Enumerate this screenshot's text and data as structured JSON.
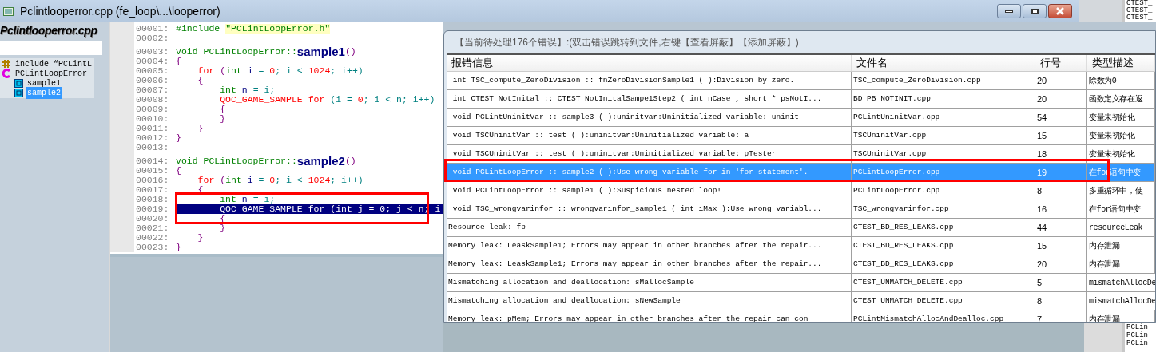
{
  "window": {
    "title": "Pclintlooperror.cpp (fe_loop\\...\\looperror)"
  },
  "side_list_top": [
    "CTEST_",
    "CTEST_",
    "CTEST_"
  ],
  "side_list_bottom": [
    "PCLin",
    "PCLin",
    "PCLin"
  ],
  "file_panel": {
    "title": "Pclintlooperror.cpp",
    "tree": [
      {
        "kind": "include",
        "label": "include “PCLintL",
        "selected": false
      },
      {
        "kind": "class",
        "label": "PCLintLoopError",
        "selected": false,
        "children": [
          {
            "kind": "method",
            "label": "sample1",
            "selected": false
          },
          {
            "kind": "method",
            "label": "sample2",
            "selected": true
          }
        ]
      }
    ]
  },
  "editor": {
    "lines": [
      {
        "number": "00001:",
        "selected": false,
        "tokens": [
          {
            "kind": "pp",
            "t": "#include "
          },
          {
            "kind": "str",
            "t": "\"PCLintLoopError.h\""
          }
        ]
      },
      {
        "number": "00002:",
        "selected": false
      },
      {
        "number": "00003:",
        "selected": false,
        "tokens": [
          {
            "kind": "type",
            "t": "void PCLintLoopError::"
          },
          {
            "kind": "fn",
            "t": "sample1"
          },
          {
            "kind": "br",
            "t": "()"
          }
        ]
      },
      {
        "number": "00004:",
        "selected": false,
        "tokens": [
          {
            "kind": "br",
            "t": "{"
          }
        ]
      },
      {
        "number": "00005:",
        "selected": false,
        "tokens": [
          {
            "kind": "kw",
            "t": "    for "
          },
          {
            "kind": "br",
            "t": "("
          },
          {
            "kind": "type",
            "t": "int "
          },
          {
            "kind": "id",
            "t": "i"
          },
          {
            "kind": "op",
            "t": " = "
          },
          {
            "kind": "num",
            "t": "0"
          },
          {
            "kind": "op",
            "t": "; i < "
          },
          {
            "kind": "num",
            "t": "1024"
          },
          {
            "kind": "op",
            "t": "; i++)"
          }
        ]
      },
      {
        "number": "00006:",
        "selected": false,
        "tokens": [
          {
            "kind": "br",
            "t": "    {"
          }
        ]
      },
      {
        "number": "00007:",
        "selected": false,
        "tokens": [
          {
            "kind": "type",
            "t": "        int "
          },
          {
            "kind": "id",
            "t": "n"
          },
          {
            "kind": "op",
            "t": " = i;"
          }
        ]
      },
      {
        "number": "00008:",
        "selected": false,
        "tokens": [
          {
            "kind": "kw",
            "t": "        QOC_GAME_SAMPLE for "
          },
          {
            "kind": "op",
            "t": "(i = "
          },
          {
            "kind": "num",
            "t": "0"
          },
          {
            "kind": "op",
            "t": "; i < n; i++)"
          }
        ]
      },
      {
        "number": "00009:",
        "selected": false,
        "tokens": [
          {
            "kind": "br",
            "t": "        {"
          }
        ]
      },
      {
        "number": "00010:",
        "selected": false,
        "tokens": [
          {
            "kind": "br",
            "t": "        }"
          }
        ]
      },
      {
        "number": "00011:",
        "selected": false,
        "tokens": [
          {
            "kind": "br",
            "t": "    }"
          }
        ]
      },
      {
        "number": "00012:",
        "selected": false,
        "tokens": [
          {
            "kind": "br",
            "t": "}"
          }
        ]
      },
      {
        "number": "00013:",
        "selected": false
      },
      {
        "number": "00014:",
        "selected": false,
        "tokens": [
          {
            "kind": "type",
            "t": "void PCLintLoopError::"
          },
          {
            "kind": "fn",
            "t": "sample2"
          },
          {
            "kind": "br",
            "t": "()"
          }
        ]
      },
      {
        "number": "00015:",
        "selected": false,
        "tokens": [
          {
            "kind": "br",
            "t": "{"
          }
        ]
      },
      {
        "number": "00016:",
        "selected": false,
        "tokens": [
          {
            "kind": "kw",
            "t": "    for "
          },
          {
            "kind": "br",
            "t": "("
          },
          {
            "kind": "type",
            "t": "int "
          },
          {
            "kind": "id",
            "t": "i"
          },
          {
            "kind": "op",
            "t": " = "
          },
          {
            "kind": "num",
            "t": "0"
          },
          {
            "kind": "op",
            "t": "; i < "
          },
          {
            "kind": "num",
            "t": "1024"
          },
          {
            "kind": "op",
            "t": "; i++)"
          }
        ]
      },
      {
        "number": "00017:",
        "selected": false,
        "tokens": [
          {
            "kind": "br",
            "t": "    {"
          }
        ]
      },
      {
        "number": "00018:",
        "selected": false,
        "tokens": [
          {
            "kind": "type",
            "t": "        int "
          },
          {
            "kind": "id",
            "t": "n"
          },
          {
            "kind": "op",
            "t": " = i;"
          }
        ]
      },
      {
        "number": "00019:",
        "selected": true,
        "tokens": [
          {
            "kind": "kw",
            "t": "        QOC_GAME_SAMPLE for "
          },
          {
            "kind": "op",
            "t": "(int j = "
          },
          {
            "kind": "num",
            "t": "0"
          },
          {
            "kind": "op",
            "t": "; j < n; i"
          }
        ]
      },
      {
        "number": "00020:",
        "selected": false,
        "tokens": [
          {
            "kind": "br",
            "t": "        {"
          }
        ]
      },
      {
        "number": "00021:",
        "selected": false,
        "tokens": [
          {
            "kind": "br",
            "t": "        }"
          }
        ]
      },
      {
        "number": "00022:",
        "selected": false,
        "tokens": [
          {
            "kind": "br",
            "t": "    }"
          }
        ]
      },
      {
        "number": "00023:",
        "selected": false,
        "tokens": [
          {
            "kind": "br",
            "t": "}"
          }
        ]
      }
    ]
  },
  "error_dialog": {
    "header": "【当前待处理176个错误】:(双击错误跳转到文件,右键【查看屏蔽】【添加屏蔽】)",
    "columns": [
      "报错信息",
      "文件名",
      "行号",
      "类型描述"
    ],
    "rows": [
      {
        "message": " int TSC_compute_ZeroDivision :: fnZeroDivisionSample1 ( ):Division by zero.",
        "file": "TSC_compute_ZeroDivision.cpp",
        "line": "20",
        "type": "除数为0",
        "selected": false
      },
      {
        "message": " int CTEST_NotInital :: CTEST_NotInitalSampe1Step2 ( int nCase , short * psNotI...",
        "file": "BD_PB_NOTINIT.cpp",
        "line": "20",
        "type": "函数定义存在返",
        "selected": false
      },
      {
        "message": " void PCLintUninitVar :: sample3 ( ):uninitvar:Uninitialized variable: uninit",
        "file": "PCLintUninitVar.cpp",
        "line": "54",
        "type": "变量未初始化",
        "selected": false
      },
      {
        "message": " void TSCUninitVar :: test ( ):uninitvar:Uninitialized variable: a",
        "file": "TSCUninitVar.cpp",
        "line": "15",
        "type": "变量未初始化",
        "selected": false
      },
      {
        "message": " void TSCUninitVar :: test ( ):uninitvar:Uninitialized variable: pTester",
        "file": "TSCUninitVar.cpp",
        "line": "18",
        "type": "变量未初始化",
        "selected": false
      },
      {
        "message": " void PCLintLoopError :: sample2 ( ):Use wrong variable for in 'for statement'.",
        "file": "PCLintLoopError.cpp",
        "line": "19",
        "type": "在for语句中变",
        "selected": true
      },
      {
        "message": " void PCLintLoopError :: sample1 ( ):Suspicious nested loop!",
        "file": "PCLintLoopError.cpp",
        "line": "8",
        "type": "多重循环中，使",
        "selected": false
      },
      {
        "message": " void TSC_wrongvarinfor :: wrongvarinfor_sample1 ( int iMax ):Use wrong variabl...",
        "file": "TSC_wrongvarinfor.cpp",
        "line": "16",
        "type": "在for语句中变",
        "selected": false
      },
      {
        "message": "Resource leak: fp",
        "file": "CTEST_BD_RES_LEAKS.cpp",
        "line": "44",
        "type": "resourceLeak",
        "selected": false
      },
      {
        "message": "Memory leak: LeaskSample1; Errors may appear in other branches after the repair...",
        "file": "CTEST_BD_RES_LEAKS.cpp",
        "line": "15",
        "type": "内存泄漏",
        "selected": false
      },
      {
        "message": "Memory leak: LeaskSample1; Errors may appear in other branches after the repair...",
        "file": "CTEST_BD_RES_LEAKS.cpp",
        "line": "20",
        "type": "内存泄漏",
        "selected": false
      },
      {
        "message": "Mismatching allocation and deallocation: sMallocSample",
        "file": "CTEST_UNMATCH_DELETE.cpp",
        "line": "5",
        "type": "mismatchAllocDe",
        "selected": false
      },
      {
        "message": "Mismatching allocation and deallocation: sNewSample",
        "file": "CTEST_UNMATCH_DELETE.cpp",
        "line": "8",
        "type": "mismatchAllocDe",
        "selected": false
      },
      {
        "message": "Memory leak: pMem; Errors may appear in other branches after the repair can con",
        "file": "PCLintMismatchAllocAndDealloc.cpp",
        "line": "7",
        "type": "内存泄漏",
        "selected": false
      }
    ]
  }
}
